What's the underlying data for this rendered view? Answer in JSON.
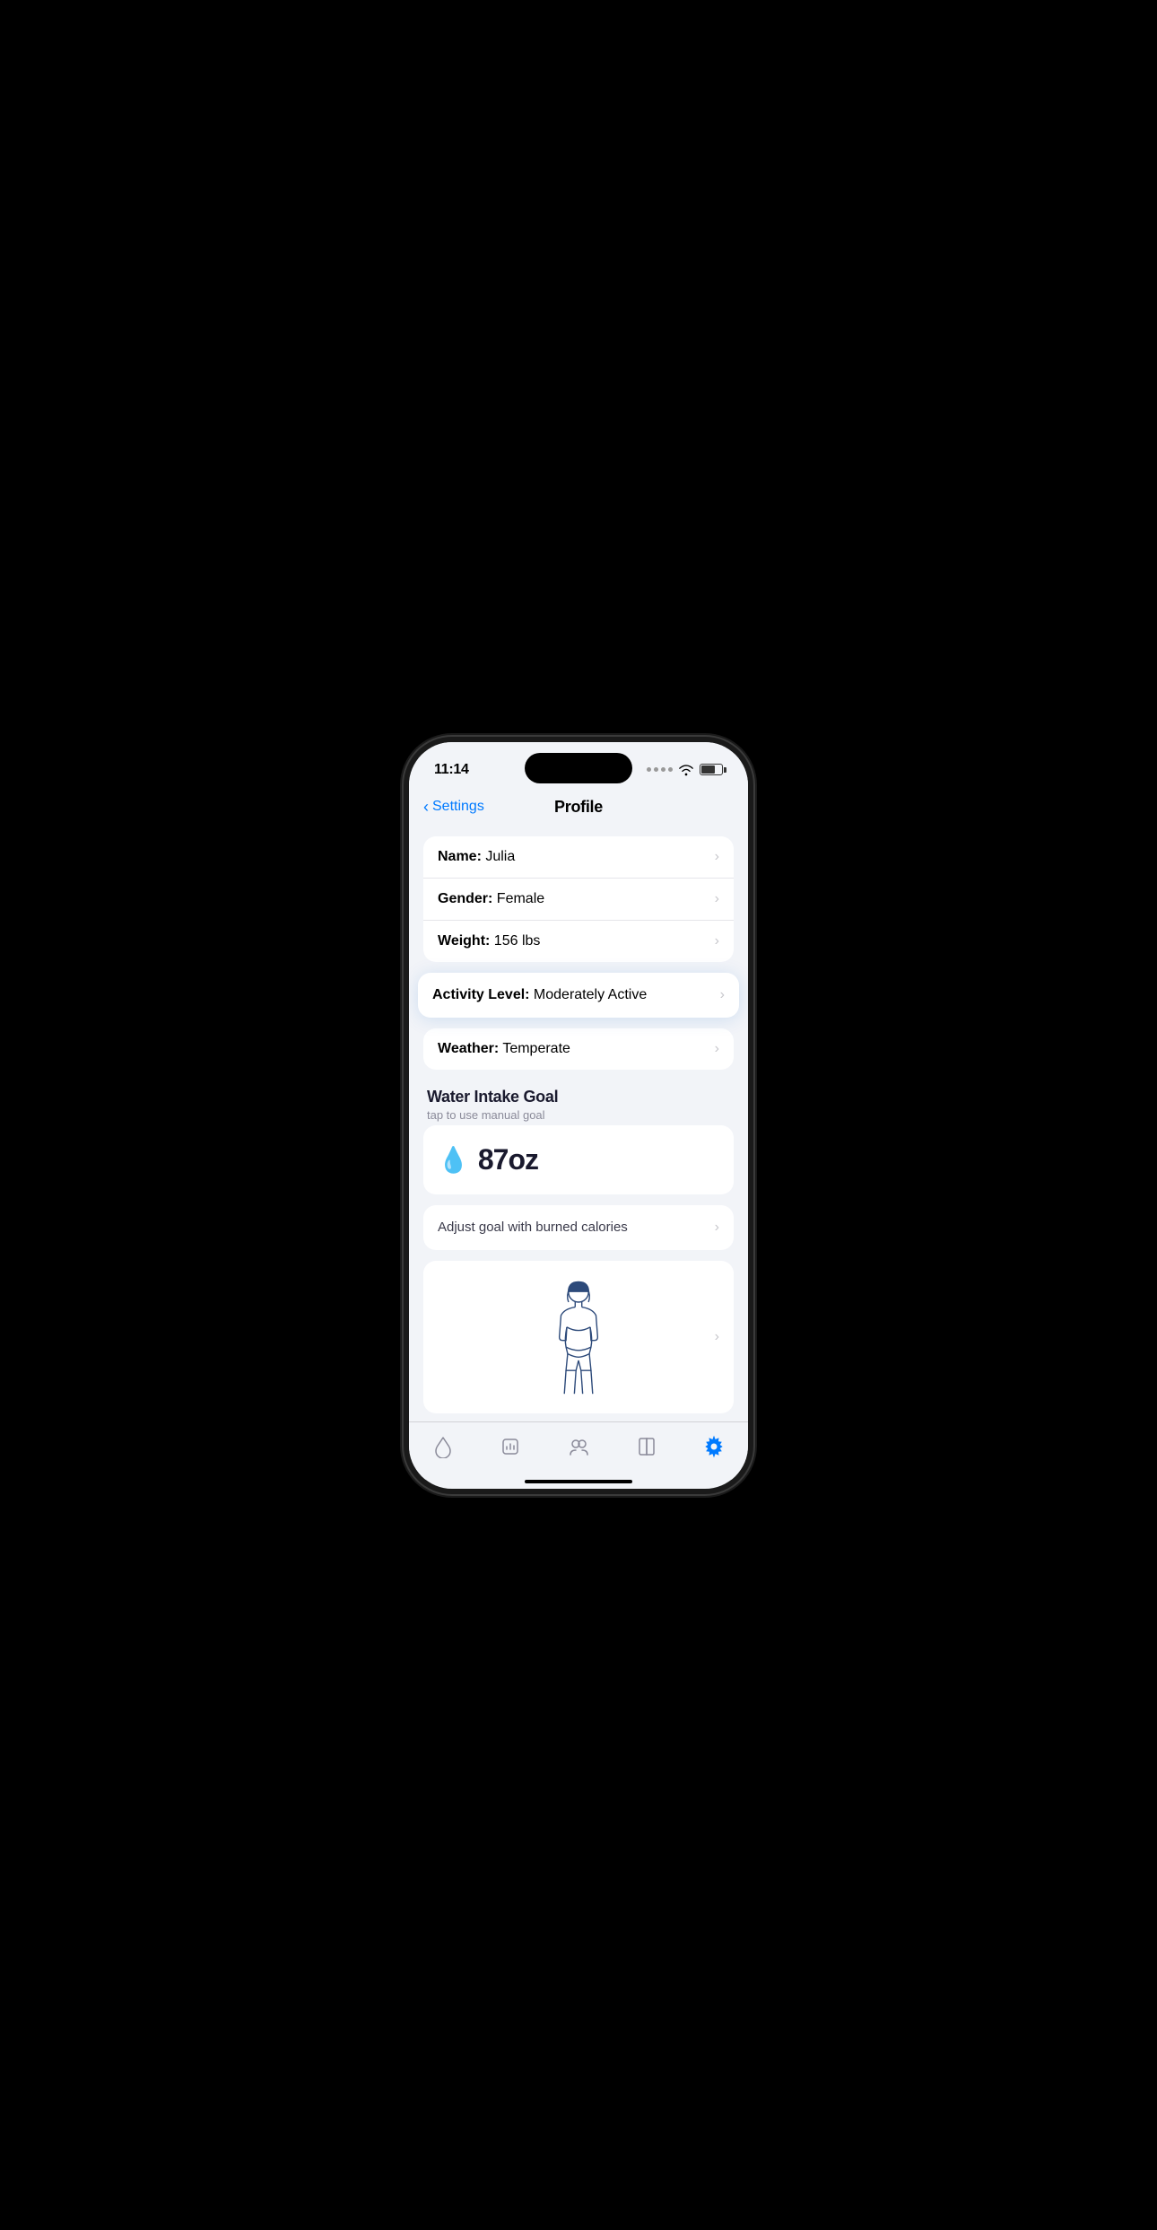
{
  "status_bar": {
    "time": "11:14",
    "signal": "dots",
    "wifi": "wifi",
    "battery": "battery"
  },
  "nav": {
    "back_label": "Settings",
    "title": "Profile"
  },
  "profile_items": [
    {
      "label": "Name",
      "value": "Julia"
    },
    {
      "label": "Gender",
      "value": "Female"
    },
    {
      "label": "Weight",
      "value": "156 lbs"
    }
  ],
  "activity_level": {
    "label": "Activity Level",
    "value": "Moderately Active"
  },
  "weather_item": {
    "label": "Weather",
    "value": "Temperate"
  },
  "water_intake": {
    "section_title": "Water Intake Goal",
    "section_subtitle": "tap to use manual goal",
    "amount": "87oz",
    "drop_icon": "💧"
  },
  "adjust_goal": {
    "label": "Adjust goal with burned calories"
  },
  "tab_bar": {
    "items": [
      {
        "name": "water",
        "label": ""
      },
      {
        "name": "chart",
        "label": ""
      },
      {
        "name": "profile",
        "label": ""
      },
      {
        "name": "book",
        "label": ""
      },
      {
        "name": "settings",
        "label": ""
      }
    ],
    "active_index": 4
  },
  "colors": {
    "accent": "#007AFF",
    "background": "#f2f4f8",
    "card": "#ffffff",
    "text_primary": "#1a1a2e",
    "text_secondary": "#8a8a99",
    "active_tab": "#007AFF",
    "inactive_tab": "#8a8a99"
  }
}
